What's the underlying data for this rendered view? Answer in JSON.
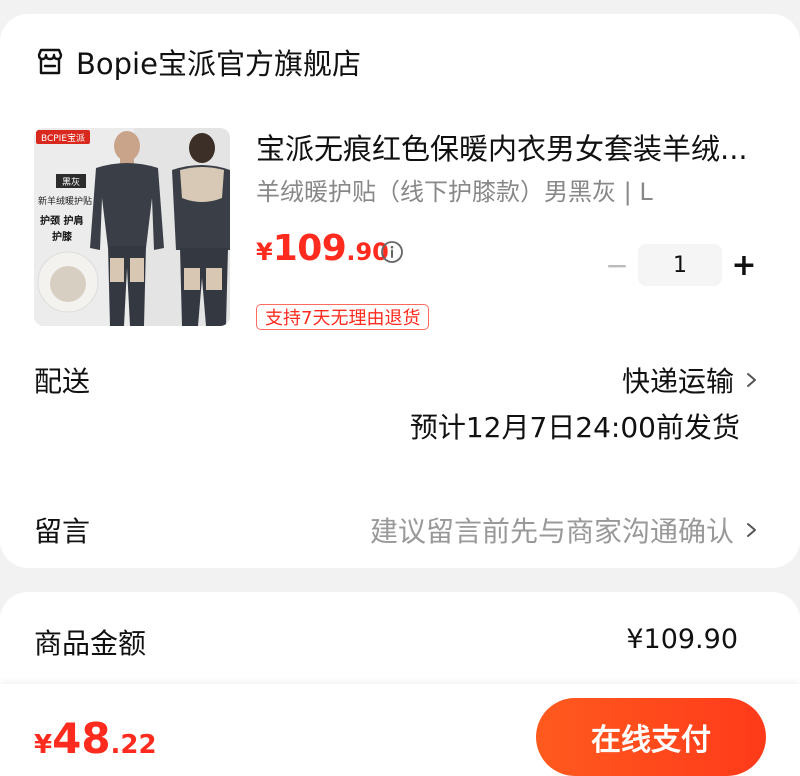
{
  "shop": {
    "name": "Bopie宝派官方旗舰店",
    "icon": "store-icon"
  },
  "product": {
    "image_brand": "BCPIE宝派",
    "image_tag": "黑灰",
    "image_text1": "新羊绒暖护贴",
    "image_text2": "护颈 护肩",
    "image_text3": "护膝",
    "title": "宝派无痕红色保暖内衣男女套装羊绒...",
    "sku": "羊绒暖护贴（线下护膝款）男黑灰 | L",
    "price_symbol": "¥",
    "price_int": "109",
    "price_dec": ".90",
    "quantity": "1",
    "minus": "−",
    "plus": "+",
    "badge": "支持7天无理由退货"
  },
  "delivery": {
    "label": "配送",
    "method": "快递运输",
    "estimate": "预计12月7日24:00前发货"
  },
  "note": {
    "label": "留言",
    "placeholder": "建议留言前先与商家沟通确认"
  },
  "summary": {
    "goods_label": "商品金额",
    "goods_value": "¥109.90"
  },
  "bottom": {
    "total_symbol": "¥",
    "total_int": "48",
    "total_dec": ".22",
    "pay_label": "在线支付"
  },
  "colors": {
    "accent": "#ff2b1f",
    "button": "#ff4a1c"
  }
}
